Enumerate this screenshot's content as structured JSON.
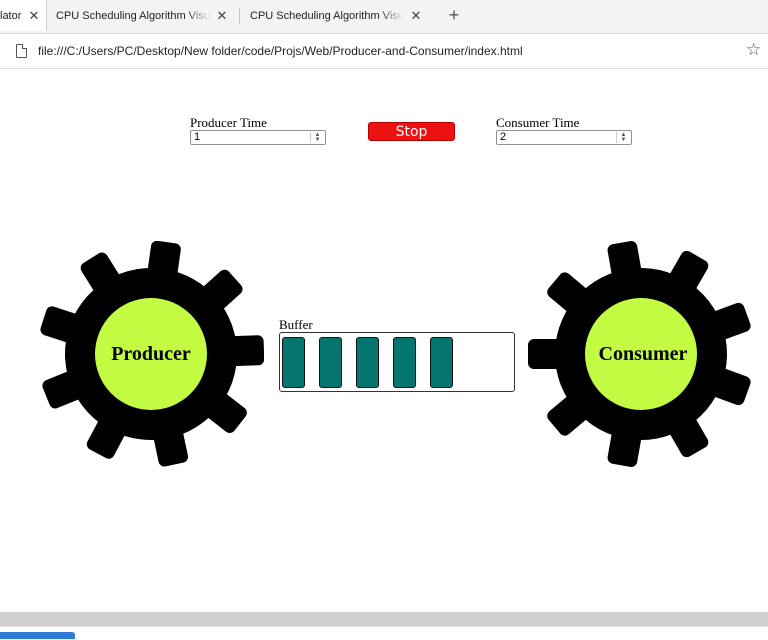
{
  "browser": {
    "tabs": [
      {
        "label": "lator",
        "active": true
      },
      {
        "label": "CPU Scheduling Algorithm Visualize",
        "active": false
      },
      {
        "label": "CPU Scheduling Algorithm Visualize",
        "active": false
      }
    ],
    "tab_close_glyph": "✕",
    "new_tab_glyph": "+",
    "url": "file:///C:/Users/PC/Desktop/New folder/code/Projs/Web/Producer-and-Consumer/index.html",
    "icons": {
      "page": "page-icon",
      "bookmark": "star-icon"
    }
  },
  "controls": {
    "producer_time_label": "Producer Time",
    "producer_time_value": "1",
    "stop_label": "Stop",
    "consumer_time_label": "Consumer Time",
    "consumer_time_value": "2"
  },
  "producer": {
    "label": "Producer"
  },
  "consumer": {
    "label": "Consumer"
  },
  "buffer": {
    "label": "Buffer",
    "filled_slots": 5
  },
  "colors": {
    "gear": "#000000",
    "gear_center": "#c2fb42",
    "buffer_item": "#04756f",
    "stop_button": "#ee1111"
  }
}
